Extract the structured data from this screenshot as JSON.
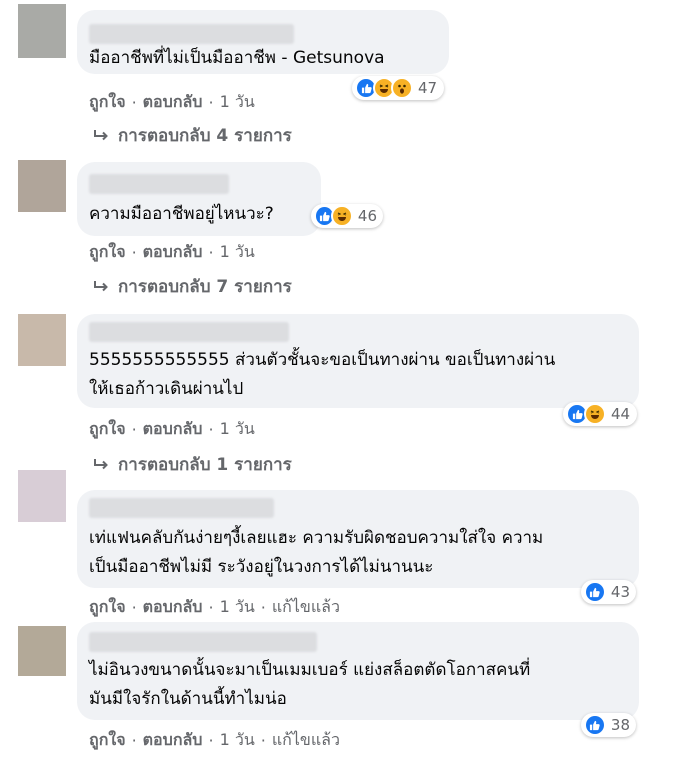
{
  "comments": [
    {
      "text": "มืออาชีพที่ไม่เป็นมืออาชีพ - Getsunova",
      "reaction_count": "47",
      "reactions": [
        "like-icon",
        "haha-icon",
        "wow-icon"
      ],
      "actions": {
        "like": "ถูกใจ",
        "reply": "ตอบกลับ",
        "time": "1 วัน"
      },
      "replies_label": "การตอบกลับ 4 รายการ"
    },
    {
      "text": "ความมืออาชีพอยู่ไหนวะ?",
      "reaction_count": "46",
      "reactions": [
        "like-icon",
        "haha-icon"
      ],
      "actions": {
        "like": "ถูกใจ",
        "reply": "ตอบกลับ",
        "time": "1 วัน"
      },
      "replies_label": "การตอบกลับ 7 รายการ"
    },
    {
      "text": "5555555555555 ส่วนตัวชั้นจะขอเป็นทางผ่าน ขอเป็นทางผ่าน\nให้เธอก้าวเดินผ่านไป",
      "reaction_count": "44",
      "reactions": [
        "like-icon",
        "haha-icon"
      ],
      "actions": {
        "like": "ถูกใจ",
        "reply": "ตอบกลับ",
        "time": "1 วัน"
      },
      "replies_label": "การตอบกลับ 1 รายการ"
    },
    {
      "text": "เท่แฟนคลับกันง่ายๆงี้เลยแฮะ ความรับผิดชอบความใส่ใจ ความ\nเป็นมืออาชีพไม่มี ระวังอยู่ในวงการได้ไม่นานนะ",
      "reaction_count": "43",
      "reactions": [
        "like-icon"
      ],
      "actions": {
        "like": "ถูกใจ",
        "reply": "ตอบกลับ",
        "time": "1 วัน",
        "edited": "แก้ไขแล้ว"
      }
    },
    {
      "text": "ไม่อินวงขนาดนั้นจะมาเป็นเมมเบอร์ แย่งสล็อตตัดโอกาสคนที่\nมันมีใจรักในด้านนี้ทำไมน่อ",
      "reaction_count": "38",
      "reactions": [
        "like-icon"
      ],
      "actions": {
        "like": "ถูกใจ",
        "reply": "ตอบกลับ",
        "time": "1 วัน",
        "edited": "แก้ไขแล้ว"
      }
    }
  ],
  "colors": {
    "bubble": "#f0f2f5",
    "like": "#1877f2",
    "haha": "#f7b125",
    "meta": "#65676b"
  }
}
